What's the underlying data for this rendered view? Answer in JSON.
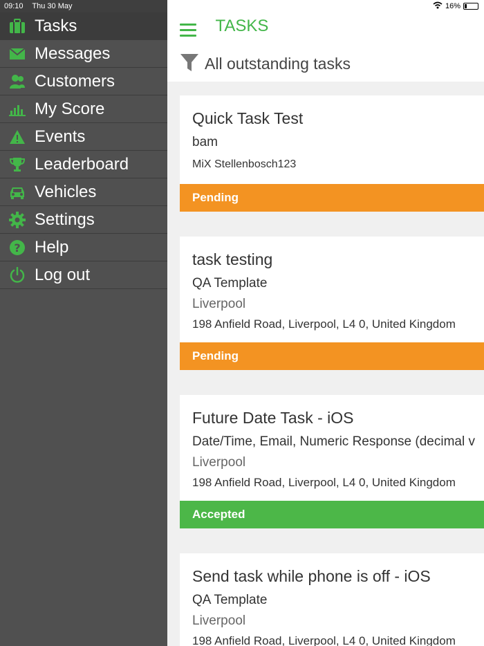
{
  "status_bar": {
    "time": "09:10",
    "date": "Thu 30 May",
    "battery": "16%",
    "battery_level": 0.16
  },
  "sidebar": {
    "items": [
      {
        "label": "Tasks",
        "icon": "briefcase-icon"
      },
      {
        "label": "Messages",
        "icon": "envelope-icon"
      },
      {
        "label": "Customers",
        "icon": "users-icon"
      },
      {
        "label": "My Score",
        "icon": "bar-chart-icon"
      },
      {
        "label": "Events",
        "icon": "warning-icon"
      },
      {
        "label": "Leaderboard",
        "icon": "trophy-icon"
      },
      {
        "label": "Vehicles",
        "icon": "car-icon"
      },
      {
        "label": "Settings",
        "icon": "gear-icon"
      },
      {
        "label": "Help",
        "icon": "help-icon"
      },
      {
        "label": "Log out",
        "icon": "power-icon"
      }
    ]
  },
  "header": {
    "title": "TASKS",
    "filter_label": "All outstanding tasks"
  },
  "tasks": [
    {
      "title": "Quick Task Test",
      "subtitle": "bam",
      "company": "MiX Stellenbosch123",
      "status": "Pending"
    },
    {
      "title": "task testing",
      "subtitle": "QA Template",
      "city": "Liverpool",
      "address": "198 Anfield Road,  Liverpool,  L4 0,  United Kingdom",
      "status": "Pending"
    },
    {
      "title": "Future Date Task - iOS",
      "subtitle": "Date/Time, Email, Numeric Response (decimal v",
      "city": "Liverpool",
      "address": "198 Anfield Road,  Liverpool,  L4 0,  United Kingdom",
      "status": "Accepted"
    },
    {
      "title": "Send task while phone is off - iOS",
      "subtitle": "QA Template",
      "city": "Liverpool",
      "address": "198 Anfield Road,  Liverpool,  L4 0,  United Kingdom"
    }
  ],
  "colors": {
    "accent": "#43b649",
    "pending": "#f39322",
    "accepted": "#4cb748",
    "sidebar": "#505050"
  }
}
